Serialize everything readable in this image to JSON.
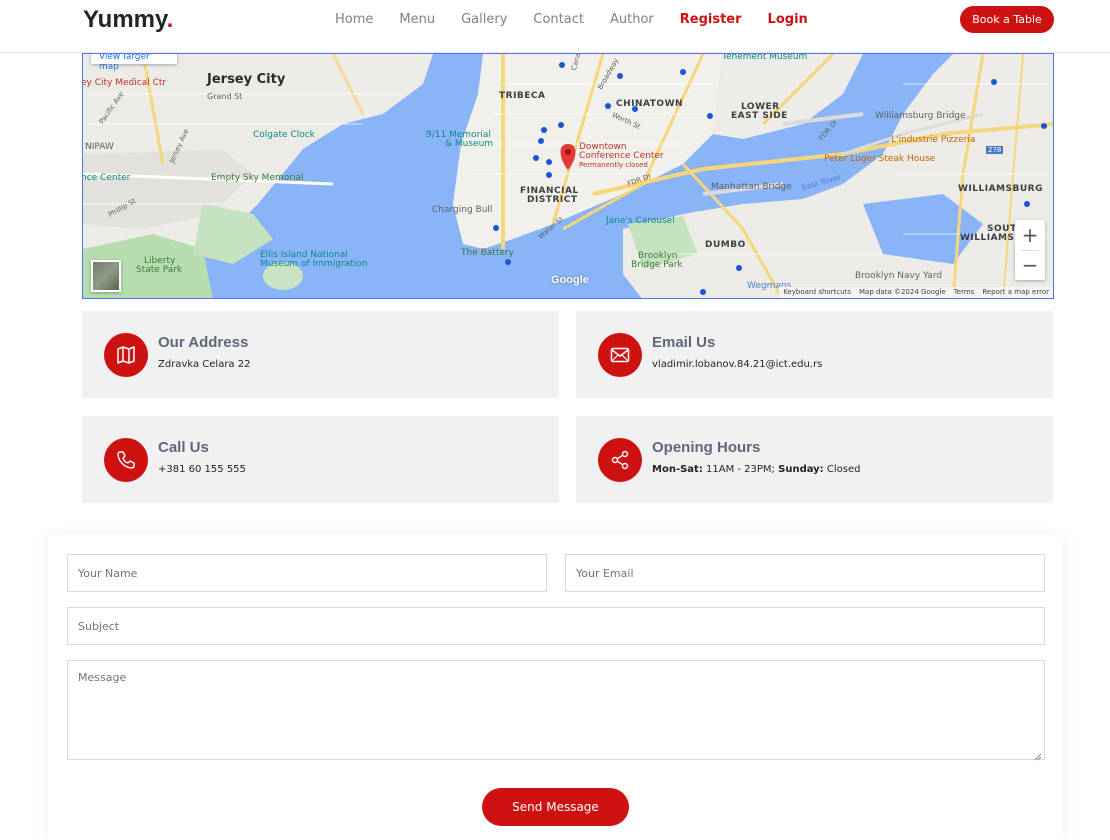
{
  "header": {
    "logo_text": "Yummy",
    "logo_dot": ".",
    "nav": [
      {
        "label": "Home",
        "accent": false
      },
      {
        "label": "Menu",
        "accent": false
      },
      {
        "label": "Gallery",
        "accent": false
      },
      {
        "label": "Contact",
        "accent": false
      },
      {
        "label": "Author",
        "accent": false
      },
      {
        "label": "Register",
        "accent": true
      },
      {
        "label": "Login",
        "accent": true
      }
    ],
    "book_button": "Book a Table"
  },
  "map": {
    "view_larger": "View larger map",
    "labels": {
      "jersey_city": "Jersey City",
      "medical_ctr": "ey City Medical Ctr",
      "grand_st": "Grand St",
      "pacific_ave": "Pacific Ave",
      "jersey_ave": "Jersey Ave",
      "nipaw": "NIPAW",
      "colgate_clock": "Colgate Clock",
      "nce_center": "nce Center",
      "empty_sky": "Empty Sky Memorial",
      "phillip_st": "Phillip St",
      "liberty_park_1": "Liberty",
      "liberty_park_2": "State Park",
      "ellis_1": "Ellis Island National",
      "ellis_2": "Museum of Immigration",
      "tenement": "Tenement Museum",
      "tribeca": "TRIBECA",
      "chinatown": "CHINATOWN",
      "lower_east_1": "LOWER",
      "lower_east_2": "EAST SIDE",
      "worth_st": "Worth St",
      "memorial_1": "9/11 Memorial",
      "memorial_2": "& Museum",
      "downtown_1": "Downtown",
      "downtown_2": "Conference Center",
      "downtown_3": "Permanently closed",
      "financial_1": "FINANCIAL",
      "financial_2": "DISTRICT",
      "fdr_dr_1": "FDR Dr",
      "fdr_dr_2": "FDR Dr",
      "charging_bull": "Charging Bull",
      "water_st": "Water St",
      "janes_carousel": "Jane's Carousel",
      "the_battery": "The Battery",
      "brooklyn_bridge_park_1": "Brooklyn",
      "brooklyn_bridge_park_2": "Bridge Park",
      "dumbo": "DUMBO",
      "manhattan_bridge": "Manhattan Bridge",
      "east_river": "East River",
      "williamsburg_bridge": "Williamsburg Bridge",
      "lindustrie": "L'industrie Pizzeria",
      "peter_luger": "Peter Luger Steak House",
      "williamsburg": "WILLIAMSBURG",
      "south_w_1": "SOUTH",
      "south_w_2": "WILLIAMSB",
      "brooklyn_navy": "Brooklyn Navy Yard",
      "wegmans": "Wegmans",
      "broadway": "Broadway",
      "canal_st": "Canal St",
      "route_278": "278"
    },
    "zoom_in": "+",
    "zoom_out": "−",
    "google": "Google",
    "attribution": [
      "Keyboard shortcuts",
      "Map data ©2024 Google",
      "Terms",
      "Report a map error"
    ]
  },
  "cards": {
    "address": {
      "title": "Our Address",
      "text": "Zdravka Celara 22",
      "icon": "map-icon"
    },
    "email": {
      "title": "Email Us",
      "text": "vladimir.lobanov.84.21@ict.edu.rs",
      "icon": "envelope-icon"
    },
    "call": {
      "title": "Call Us",
      "text": "+381 60 155 555",
      "icon": "phone-icon"
    },
    "hours": {
      "title": "Opening Hours",
      "icon": "share-icon",
      "weekdays_label": "Mon-Sat:",
      "weekdays_value": "11AM - 23PM;",
      "sunday_label": "Sunday:",
      "sunday_value": "Closed"
    }
  },
  "form": {
    "name_placeholder": "Your Name",
    "email_placeholder": "Your Email",
    "subject_placeholder": "Subject",
    "message_placeholder": "Message",
    "send_button": "Send Message"
  },
  "colors": {
    "accent": "#ce1212",
    "card_bg": "#f1f1f1",
    "heading": "#5f687b",
    "nav_text": "#7f7f90",
    "water": "#8ab4f8"
  }
}
